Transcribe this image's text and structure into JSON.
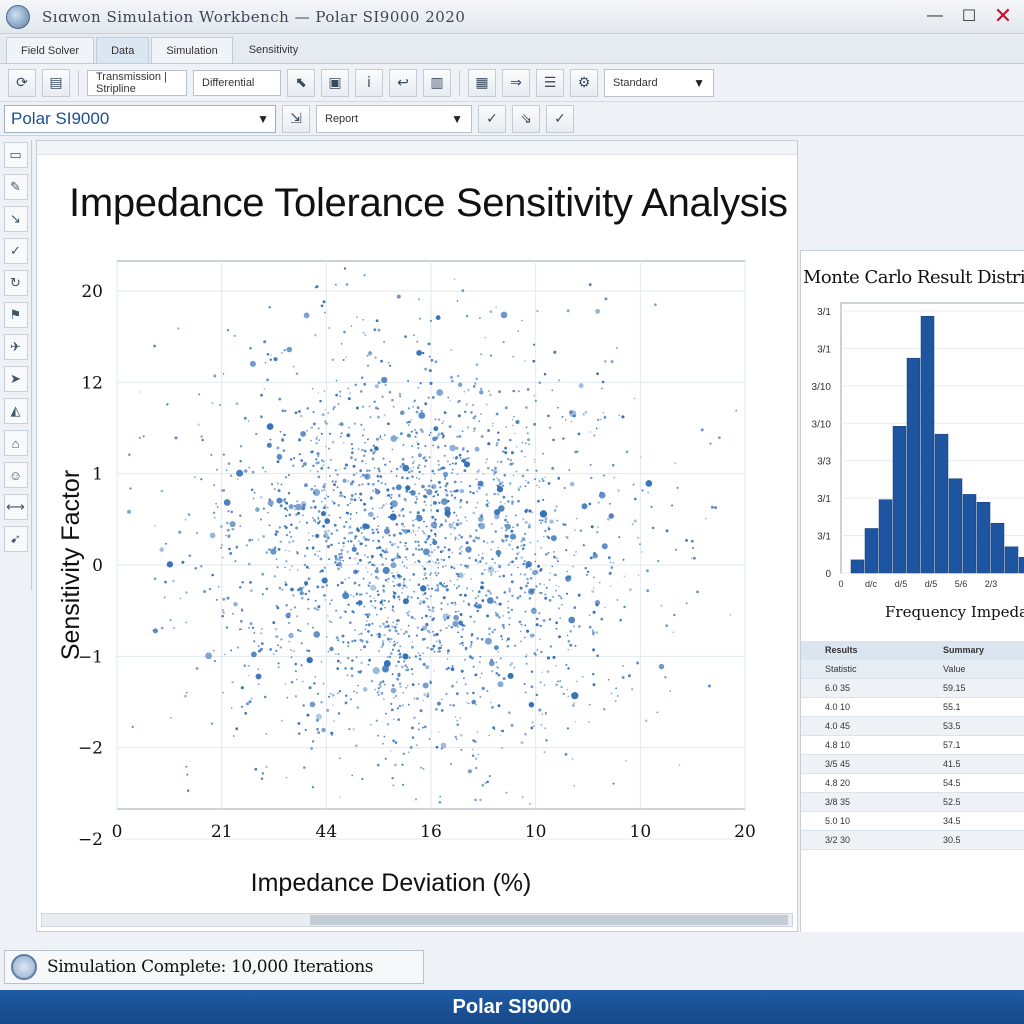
{
  "window": {
    "title": "Sıɑwon Simulation Workbench — Polar SI9000 2020",
    "minimize": "—",
    "maximize": "☐",
    "close": "✕"
  },
  "tabs": [
    {
      "label": "Field Solver"
    },
    {
      "label": "Data"
    },
    {
      "label": "Simulation"
    },
    {
      "label": "Sensitivity"
    }
  ],
  "toolbar": {
    "field_value": "Transmission | Stripline",
    "field_value_2": "Differential",
    "select_right": "Standard"
  },
  "toolbar2": {
    "brand_select": "Polar SI9000",
    "param_select": "Report"
  },
  "main": {
    "title": "Impedance Tolerance Sensitivity Analysis",
    "xlabel": "Impedance Deviation (%)",
    "ylabel": "Sensitivity Factor",
    "x_ticks": [
      "0",
      "21",
      "44",
      "16",
      "10",
      "10",
      "20"
    ],
    "y_ticks": [
      "20",
      "12",
      "1",
      "0",
      "−1",
      "−2",
      "−2"
    ]
  },
  "side": {
    "hist_title": "Monte Carlo Result Distrib",
    "hist_xlabel": "Frequency Impedance",
    "hist_y_ticks": [
      "3/1",
      "3/1",
      "3/10",
      "3/10",
      "3/3",
      "3/1",
      "3/1",
      "0"
    ],
    "hist_x_ticks": [
      "0",
      "d/c",
      "d/5",
      "d/5",
      "5/6",
      "2/3"
    ],
    "table_header": [
      "Results",
      "Summary"
    ],
    "table_subheader": [
      "Statistic",
      "Value"
    ],
    "rows": [
      [
        "6.0 35",
        "59.15"
      ],
      [
        "4.0 10",
        "55.1"
      ],
      [
        "4.0 45",
        "53.5"
      ],
      [
        "4.8 10",
        "57.1"
      ],
      [
        "3/5 45",
        "41.5"
      ],
      [
        "4.8 20",
        "54.5"
      ],
      [
        "3/8 35",
        "52.5"
      ],
      [
        "5.0 10",
        "34.5"
      ],
      [
        "3/2 30",
        "30.5"
      ]
    ]
  },
  "status": {
    "text": "Simulation Complete: 10,000 Iterations"
  },
  "footer": {
    "text": "Polar SI9000"
  },
  "chart_data": [
    {
      "type": "scatter",
      "title": "Impedance Tolerance Sensitivity Analysis",
      "xlabel": "Impedance Deviation (%)",
      "ylabel": "Sensitivity Factor",
      "x_tick_labels": [
        "0",
        "21",
        "44",
        "16",
        "10",
        "10",
        "20"
      ],
      "y_tick_labels": [
        "20",
        "12",
        "1",
        "0",
        "−1",
        "−2",
        "−2"
      ],
      "distribution": "2D Gaussian cloud",
      "center": [
        0.47,
        0.53
      ],
      "spread": [
        0.17,
        0.19
      ],
      "n_points": 10000,
      "grid": true,
      "color": "#2f6db5"
    },
    {
      "type": "bar",
      "title": "Monte Carlo Result Distrib",
      "xlabel": "Frequency Impedance",
      "values": [
        5,
        17,
        28,
        56,
        82,
        98,
        53,
        36,
        30,
        27,
        19,
        10,
        6,
        2
      ],
      "ylim": [
        0,
        100
      ],
      "color": "#1e55a0"
    }
  ],
  "colors": {
    "accent": "#1e55a0",
    "scatter": "#2f6db5",
    "footer": "#1a528f"
  }
}
